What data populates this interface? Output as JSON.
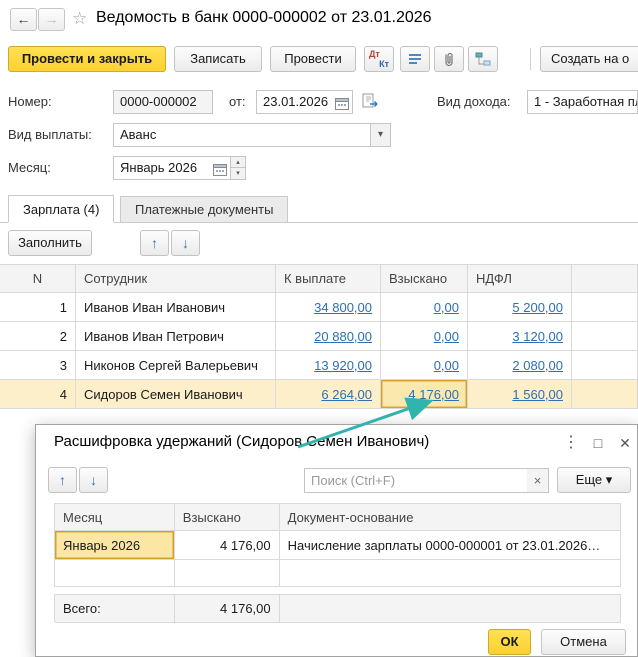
{
  "window": {
    "title": "Ведомость в банк 0000-000002 от 23.01.2026",
    "back_icon": "←",
    "forward_icon": "→",
    "favorite_icon": "☆"
  },
  "toolbar": {
    "post_and_close": "Провести и закрыть",
    "write": "Записать",
    "post": "Провести",
    "dt": "Дт",
    "kt": "Кт",
    "create_based_on": "Создать на о"
  },
  "fields": {
    "number": {
      "label": "Номер:",
      "value": "0000-000002"
    },
    "date": {
      "label": "от:",
      "value": "23.01.2026"
    },
    "income_type": {
      "label": "Вид дохода:",
      "value": "1 - Заработная пл"
    },
    "payment_type": {
      "label": "Вид выплаты:",
      "value": "Аванс",
      "arrow": "▾"
    },
    "month": {
      "label": "Месяц:",
      "value": "Январь 2026",
      "spin_up": "▴",
      "spin_down": "▾"
    }
  },
  "tabs": {
    "salary": "Зарплата (4)",
    "payment_docs": "Платежные документы"
  },
  "grid_toolbar": {
    "fill": "Заполнить",
    "up_icon": "↑",
    "down_icon": "↓"
  },
  "grid": {
    "headers": {
      "n": "N",
      "employee": "Сотрудник",
      "payout": "К выплате",
      "withheld": "Взыскано",
      "ndfl": "НДФЛ"
    },
    "rows": [
      {
        "n": "1",
        "employee": "Иванов Иван Иванович",
        "payout": "34 800,00",
        "withheld": "0,00",
        "ndfl": "5 200,00"
      },
      {
        "n": "2",
        "employee": "Иванов Иван Петрович",
        "payout": "20 880,00",
        "withheld": "0,00",
        "ndfl": "3 120,00"
      },
      {
        "n": "3",
        "employee": "Никонов Сергей Валерьевич",
        "payout": "13 920,00",
        "withheld": "0,00",
        "ndfl": "2 080,00"
      },
      {
        "n": "4",
        "employee": "Сидоров Семен Иванович",
        "payout": "6 264,00",
        "withheld": "4 176,00",
        "ndfl": "1 560,00"
      }
    ]
  },
  "dialog": {
    "title": "Расшифровка удержаний (Сидоров Семен Иванович)",
    "menu_icon": "⋮",
    "maximize_icon": "□",
    "close_icon": "✕",
    "up_icon": "↑",
    "down_icon": "↓",
    "search_placeholder": "Поиск (Ctrl+F)",
    "clear_icon": "×",
    "more": "Еще ▾",
    "headers": {
      "month": "Месяц",
      "withheld": "Взыскано",
      "document": "Документ-основание"
    },
    "rows": [
      {
        "month": "Январь 2026",
        "withheld": "4 176,00",
        "document": "Начисление зарплаты 0000-000001 от 23.01.2026…"
      }
    ],
    "total": {
      "label": "Всего:",
      "value": "4 176,00"
    },
    "ok": "ОК",
    "cancel": "Отмена"
  },
  "colors": {
    "accent_yellow": "#fcd12f",
    "link_blue": "#2e6fb5",
    "selection_yellow": "#fcefc9",
    "selected_cell_border": "#d7a42a",
    "arrow_teal": "#31b3ae"
  }
}
